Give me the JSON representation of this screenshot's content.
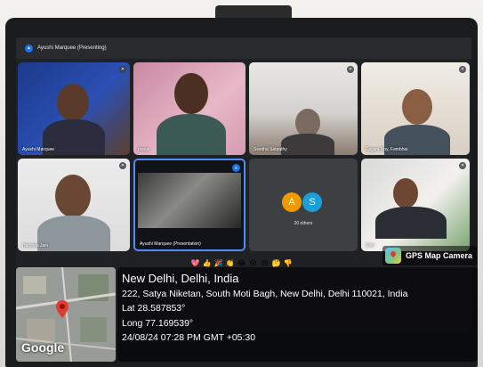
{
  "meeting": {
    "presenting_label": "Ayushi Marquee (Presenting)",
    "participants": [
      {
        "name": "Ayushi Marquee",
        "muted": true
      },
      {
        "name": "pooja",
        "muted": false
      },
      {
        "name": "Swetha Satpathy",
        "muted": true
      },
      {
        "name": "Faguni Roy, Fambhai",
        "muted": true
      },
      {
        "name": "Harshita Jain",
        "muted": true
      },
      {
        "name": "Ayushi Marquee (Presentation)",
        "speaking": true
      },
      {
        "name": "Shiv",
        "muted": true
      }
    ],
    "others": {
      "avatar_a": "A",
      "avatar_s": "S",
      "label": "20 others"
    },
    "reactions": [
      "💖",
      "👍",
      "🎉",
      "👏",
      "😂",
      "😮",
      "😢",
      "🤔",
      "👎"
    ]
  },
  "watermark": {
    "app_name": "GPS Map Camera",
    "map_logo": "Google",
    "location_title": "New Delhi, Delhi, India",
    "address": "222, Satya Niketan, South Moti Bagh, New Delhi, Delhi 110021, India",
    "latitude": "Lat 28.587853°",
    "longitude": "Long 77.169539°",
    "timestamp": "24/08/24 07:28 PM GMT +05:30"
  },
  "colors": {
    "meet_background": "#202124",
    "tile_background": "#3c4043",
    "accent_blue": "#1a73e8",
    "avatar_a": "#f29900",
    "avatar_s": "#1a9fd9",
    "overlay": "#000000"
  }
}
